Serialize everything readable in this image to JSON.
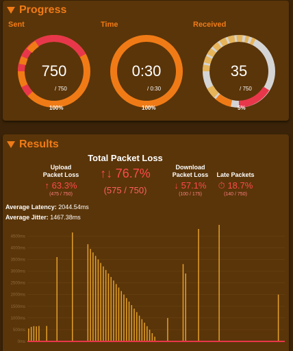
{
  "progress": {
    "title": "Progress",
    "sent": {
      "label": "Sent",
      "value": "750",
      "sub": "/ 750",
      "percent": "100%",
      "fraction": 1.0,
      "color": "#f07b16"
    },
    "time": {
      "label": "Time",
      "value": "0:30",
      "sub": "/ 0:30",
      "percent": "100%",
      "fraction": 1.0,
      "color": "#f07b16"
    },
    "received": {
      "label": "Received",
      "value": "35",
      "sub": "/ 750",
      "percent": "5%",
      "fraction": 0.05,
      "color": "#e8374a"
    }
  },
  "results": {
    "title": "Results",
    "total": {
      "label": "Total Packet Loss",
      "icon": "up-down-arrows-icon",
      "value": "76.7%",
      "sub": "(575 / 750)"
    },
    "upload": {
      "label_line1": "Upload",
      "label_line2": "Packet Loss",
      "icon": "up-arrow-icon",
      "value": "63.3%",
      "sub": "(475 / 750)"
    },
    "download": {
      "label_line1": "Download",
      "label_line2": "Packet Loss",
      "icon": "down-arrow-icon",
      "value": "57.1%",
      "sub": "(100 / 175)"
    },
    "late": {
      "label": "Late Packets",
      "icon": "stopwatch-icon",
      "value": "18.7%",
      "sub": "(140 / 750)"
    },
    "latency_label": "Average Latency:",
    "latency_value": "2044.54ms",
    "jitter_label": "Average Jitter:",
    "jitter_value": "1467.38ms"
  },
  "colors": {
    "accent": "#f07b16",
    "loss": "#ff4a4a",
    "bar": "#e6a12a"
  },
  "chart_data": {
    "type": "bar",
    "ylim": [
      0,
      4800
    ],
    "yticks": [
      "0ms",
      "500ms",
      "1000ms",
      "1500ms",
      "2000ms",
      "2500ms",
      "3000ms",
      "3500ms",
      "4000ms",
      "4500ms"
    ],
    "grid": true,
    "x": [
      1,
      2,
      3,
      4,
      5,
      6,
      7,
      8,
      9,
      10,
      11,
      12,
      13,
      14,
      15,
      16,
      17,
      18,
      19,
      20,
      21,
      22,
      23,
      24,
      25,
      26,
      27,
      28,
      29,
      30,
      31,
      32,
      33,
      34,
      35,
      36,
      37,
      38,
      39,
      40,
      41,
      42,
      43,
      44,
      45,
      46,
      47,
      48,
      49,
      50,
      51,
      52,
      53,
      54,
      55,
      56,
      57,
      58,
      59,
      60,
      61,
      62,
      63,
      64,
      65,
      66,
      67,
      68,
      69,
      70,
      71,
      72,
      73,
      74,
      75,
      76,
      77,
      78,
      79,
      80,
      81,
      82,
      83,
      84,
      85,
      86,
      87,
      88,
      89,
      90,
      91,
      92,
      93,
      94,
      95,
      96,
      97,
      98,
      99,
      100
    ],
    "values": [
      550,
      620,
      650,
      640,
      660,
      0,
      0,
      660,
      0,
      0,
      0,
      3600,
      0,
      0,
      0,
      0,
      0,
      4650,
      0,
      0,
      0,
      0,
      0,
      4150,
      3950,
      3800,
      3650,
      3500,
      3350,
      3200,
      3050,
      2900,
      2750,
      2600,
      2450,
      2300,
      2150,
      2000,
      1850,
      1700,
      1550,
      1400,
      1250,
      1100,
      950,
      800,
      650,
      500,
      350,
      200,
      0,
      0,
      0,
      0,
      1000,
      0,
      0,
      0,
      0,
      0,
      3300,
      2900,
      0,
      0,
      0,
      0,
      4800,
      0,
      0,
      0,
      0,
      0,
      0,
      0,
      5000,
      0,
      0,
      0,
      0,
      0,
      0,
      0,
      0,
      0,
      0,
      0,
      0,
      0,
      0,
      0,
      0,
      0,
      0,
      0,
      0,
      0,
      0,
      2000,
      0,
      0
    ]
  }
}
